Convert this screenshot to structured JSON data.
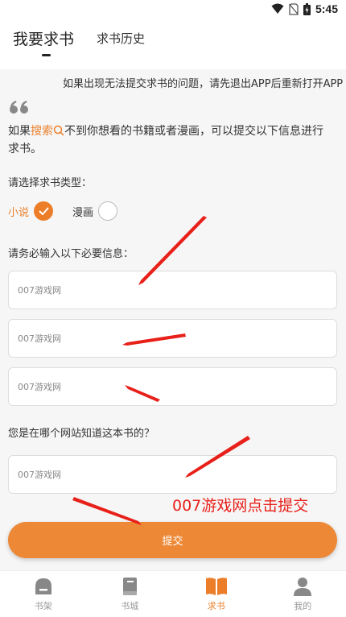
{
  "status_bar": {
    "time": "5:45"
  },
  "tabs": {
    "active": "我要求书",
    "history": "求书历史"
  },
  "notice": "如果出现无法提交求书的问题，请先退出APP后重新打开APP",
  "intro": {
    "prefix": "如果",
    "search_word": "搜索",
    "suffix": "不到你想看的书籍或者漫画，可以提交以下信息进行求书。"
  },
  "type_section": {
    "label": "请选择求书类型：",
    "options": [
      {
        "label": "小说",
        "checked": true
      },
      {
        "label": "漫画",
        "checked": false
      }
    ]
  },
  "required_label": "请务必输入以下必要信息：",
  "fields": [
    {
      "placeholder": "007游戏网"
    },
    {
      "placeholder": "007游戏网"
    },
    {
      "placeholder": "007游戏网"
    }
  ],
  "source_label": "您是在哪个网站知道这本书的？",
  "source_field": {
    "placeholder": "007游戏网"
  },
  "overlay_text": "007游戏网点击提交",
  "submit_label": "提交",
  "bottom_nav": [
    {
      "label": "书架",
      "icon": "shelf-icon",
      "active": false
    },
    {
      "label": "书城",
      "icon": "book-icon",
      "active": false
    },
    {
      "label": "求书",
      "icon": "open-book-icon",
      "active": true
    },
    {
      "label": "我的",
      "icon": "user-icon",
      "active": false
    }
  ],
  "colors": {
    "accent": "#ec7e2a",
    "annotation_red": "#e8201a"
  }
}
